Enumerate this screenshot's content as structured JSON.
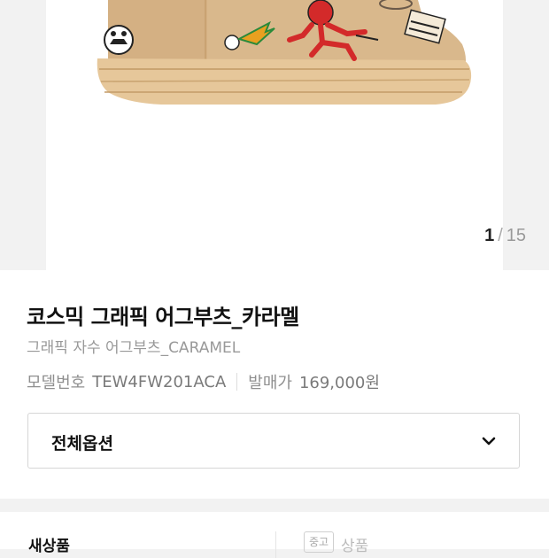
{
  "gallery": {
    "current_page": "1",
    "total_pages": "15",
    "separator": "/"
  },
  "product": {
    "title": "코스믹 그래픽 어그부츠_카라멜",
    "subtitle": "그래픽 자수 어그부츠_CARAMEL",
    "model_label": "모델번호",
    "model_number": "TEW4FW201ACA",
    "price_label": "발매가",
    "release_price": "169,000원"
  },
  "options": {
    "label": "전체옵션",
    "icon": "chevron-down-icon"
  },
  "condition_tabs": {
    "new_label": "새상품",
    "used_badge": "중고",
    "used_label": "상품"
  },
  "colors": {
    "boot": "#d9b88c",
    "sole": "#e6c79a",
    "accent_red": "#d32a2a"
  }
}
